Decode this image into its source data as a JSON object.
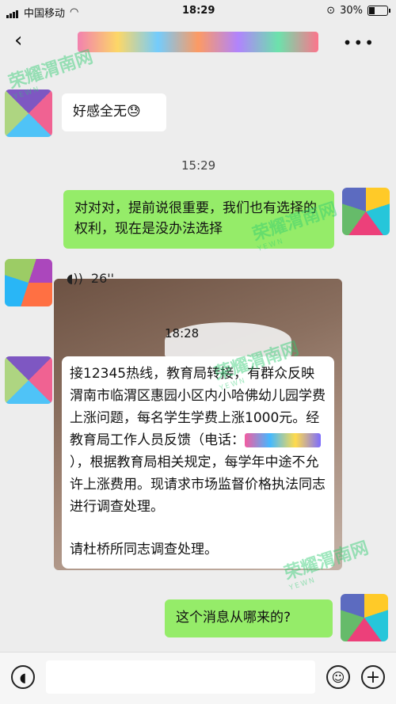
{
  "status_bar": {
    "carrier": "中国移动",
    "time": "18:29",
    "battery": "30%"
  },
  "nav": {
    "back_icon": "chevron-left-icon",
    "more_icon": "more-icon"
  },
  "messages": {
    "msg1": "好感全无😓",
    "ts1": "15:29",
    "msg2": "对对对，提前说很重要，我们也有选择的权利，现在是没办法选择",
    "voice_duration": "26''",
    "image_time": "18:28",
    "image_text_1": "接12345热线，教育局转接，有群众反映渭南市临渭区惠园小区内小哈佛幼儿园学费上涨问题，每名学生学费上涨1000元。经教育局工作人员反馈（电话：",
    "image_text_2": "），根据教育局相关规定，每学年中途不允许上涨费用。现请求市场监督价格执法同志进行调查处理。",
    "image_text_3": "请杜桥所同志调查处理。",
    "msg3": "这个消息从哪来的?"
  },
  "watermark": {
    "text": "荣耀渭南网",
    "sub": "YEWN"
  },
  "input_bar": {
    "voice_icon": "voice-icon",
    "emoji_icon": "emoji-icon",
    "plus_icon": "plus-icon"
  }
}
